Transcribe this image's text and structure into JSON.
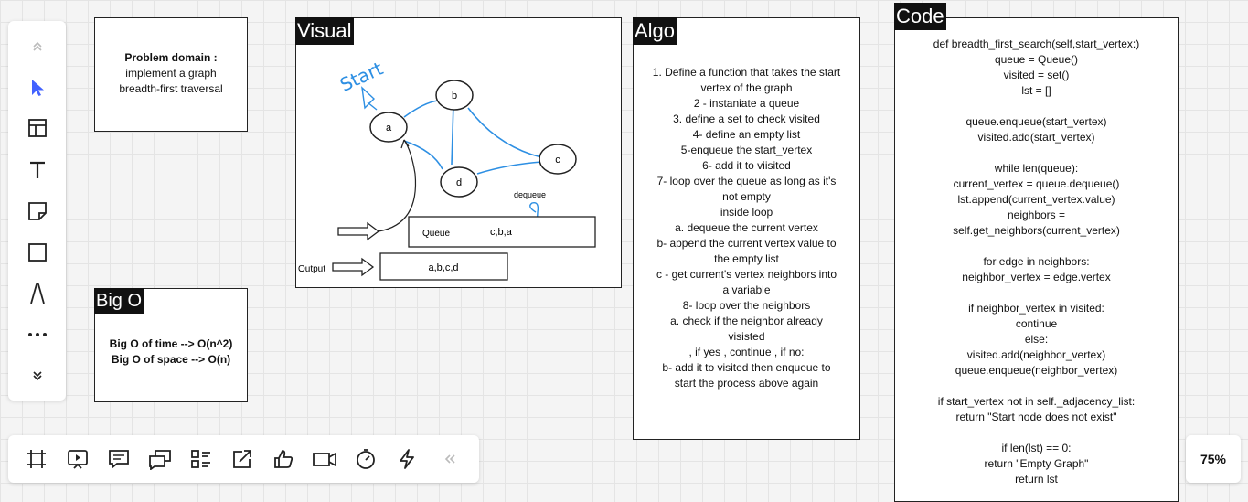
{
  "left_toolbar": {
    "tools": [
      {
        "name": "collapse-up-icon"
      },
      {
        "name": "select-cursor-icon"
      },
      {
        "name": "templates-icon"
      },
      {
        "name": "text-icon"
      },
      {
        "name": "sticky-note-icon"
      },
      {
        "name": "shape-icon"
      },
      {
        "name": "pen-icon"
      },
      {
        "name": "more-icon"
      },
      {
        "name": "expand-down-icon"
      }
    ]
  },
  "bottom_toolbar": {
    "tools": [
      "frame-icon",
      "present-icon",
      "comment-icon",
      "chat-icon",
      "card-icon",
      "share-icon",
      "reaction-icon",
      "video-icon",
      "timer-icon",
      "voting-icon",
      "collapse-icon"
    ]
  },
  "zoom": {
    "label": "75%"
  },
  "problem": {
    "title": "Problem domain :",
    "lines": [
      "implement a graph",
      "breadth-first traversal"
    ]
  },
  "bigo": {
    "title": "Big O",
    "time": "Big O of time --> O(n^2)",
    "space": "Big O of space --> O(n)"
  },
  "visual": {
    "title": "Visual",
    "start_label": "Start",
    "nodes": [
      "a",
      "b",
      "c",
      "d"
    ],
    "dequeue_label": "dequeue",
    "queue_label": "Queue",
    "queue_values": "c,b,a",
    "output_label": "Output",
    "output_values": "a,b,c,d"
  },
  "algo": {
    "title": "Algo",
    "lines": [
      "1. Define a function that takes the start",
      "vertex of the graph",
      "2 - instaniate a queue",
      "3. define a set to check visited",
      "4- define an empty list",
      "5-enqueue the start_vertex",
      "6-  add it to viisited",
      "7- loop over the queue as long as it's",
      "not empty",
      "inside loop",
      "a. dequeue the current vertex",
      "b- append the current vertex value to",
      "the empty list",
      "c - get current's vertex neighbors into",
      "a variable",
      "8- loop over the neighbors",
      "a. check if the neighbor already",
      "visisted",
      ", if yes , continue , if no:",
      "b- add it to visited then enqueue to",
      "start the process above again"
    ]
  },
  "code": {
    "title": "Code",
    "lines": [
      "def breadth_first_search(self,start_vertex:)",
      "queue = Queue()",
      "visited = set()",
      "lst = []",
      "",
      "queue.enqueue(start_vertex)",
      "visited.add(start_vertex)",
      "",
      "while len(queue):",
      "current_vertex = queue.dequeue()",
      "lst.append(current_vertex.value)",
      "neighbors =",
      "self.get_neighbors(current_vertex)",
      "",
      "for edge in neighbors:",
      "neighbor_vertex = edge.vertex",
      "",
      "if neighbor_vertex in visited:",
      "continue",
      "else:",
      "visited.add(neighbor_vertex)",
      "queue.enqueue(neighbor_vertex)",
      "",
      "if start_vertex not in self._adjacency_list:",
      "return \"Start node does not exist\"",
      "",
      "if len(lst) == 0:",
      "return \"Empty Graph\"",
      "return lst"
    ]
  },
  "colors": {
    "accent": "#4262ff",
    "ink_blue": "#2d8fe3"
  }
}
